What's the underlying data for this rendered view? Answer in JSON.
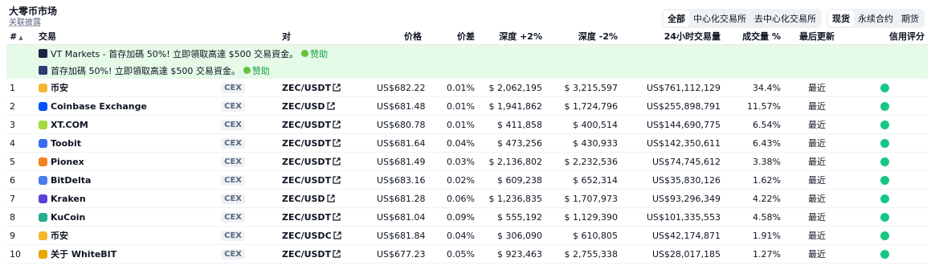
{
  "header": {
    "title": "大零币市场",
    "subtitle": "关联披露"
  },
  "filters": {
    "market_group": [
      {
        "label": "全部",
        "active": true
      },
      {
        "label": "中心化交易所",
        "active": false
      },
      {
        "label": "去中心化交易所",
        "active": false
      }
    ],
    "type_group": [
      {
        "label": "现货",
        "active": true
      },
      {
        "label": "永续合约",
        "active": false
      },
      {
        "label": "期货",
        "active": false
      }
    ]
  },
  "table": {
    "headers": {
      "rank": "#",
      "exchange": "交易",
      "pair": "对",
      "price": "价格",
      "spread": "价差",
      "depth_plus": "深度 +2%",
      "depth_minus": "深度 -2%",
      "volume": "24小时交易量",
      "volume_pct": "成交量 %",
      "updated": "最后更新",
      "trust": "信用评分"
    },
    "ads": [
      {
        "text": "VT Markets - 首存加碼 50%! 立即領取高達 $500 交易資金。",
        "sponsor": "赞助"
      },
      {
        "text": "首存加碼 50%! 立即領取高達 $500 交易資金。",
        "sponsor": "赞助"
      }
    ],
    "rows": [
      {
        "rank": "1",
        "exchange": "币安",
        "logo_color": "#f3ba2f",
        "category": "CEX",
        "pair": "ZEC/USDT",
        "price": "US$682.22",
        "spread": "0.01%",
        "depth_plus": "$ 2,062,195",
        "depth_minus": "$ 3,215,597",
        "volume": "US$761,112,129",
        "volume_pct": "34.4%",
        "updated": "最近",
        "trust_color": "#16c784"
      },
      {
        "rank": "2",
        "exchange": "Coinbase Exchange",
        "logo_color": "#0052ff",
        "category": "CEX",
        "pair": "ZEC/USD",
        "price": "US$681.48",
        "spread": "0.01%",
        "depth_plus": "$ 1,941,862",
        "depth_minus": "$ 1,724,796",
        "volume": "US$255,898,791",
        "volume_pct": "11.57%",
        "updated": "最近",
        "trust_color": "#16c784"
      },
      {
        "rank": "3",
        "exchange": "XT.COM",
        "logo_color": "#a3d93f",
        "category": "CEX",
        "pair": "ZEC/USDT",
        "price": "US$680.78",
        "spread": "0.01%",
        "depth_plus": "$ 411,858",
        "depth_minus": "$ 400,514",
        "volume": "US$144,690,775",
        "volume_pct": "6.54%",
        "updated": "最近",
        "trust_color": "#16c784"
      },
      {
        "rank": "4",
        "exchange": "Toobit",
        "logo_color": "#3d6df2",
        "category": "CEX",
        "pair": "ZEC/USDT",
        "price": "US$681.64",
        "spread": "0.04%",
        "depth_plus": "$ 473,256",
        "depth_minus": "$ 430,933",
        "volume": "US$142,350,611",
        "volume_pct": "6.43%",
        "updated": "最近",
        "trust_color": "#16c784"
      },
      {
        "rank": "5",
        "exchange": "Pionex",
        "logo_color": "#f58220",
        "category": "CEX",
        "pair": "ZEC/USDT",
        "price": "US$681.49",
        "spread": "0.03%",
        "depth_plus": "$ 2,136,802",
        "depth_minus": "$ 2,232,536",
        "volume": "US$74,745,612",
        "volume_pct": "3.38%",
        "updated": "最近",
        "trust_color": "#16c784"
      },
      {
        "rank": "6",
        "exchange": "BitDelta",
        "logo_color": "#4b7bec",
        "category": "CEX",
        "pair": "ZEC/USDT",
        "price": "US$683.16",
        "spread": "0.02%",
        "depth_plus": "$ 609,238",
        "depth_minus": "$ 652,314",
        "volume": "US$35,830,126",
        "volume_pct": "1.62%",
        "updated": "最近",
        "trust_color": "#16c784"
      },
      {
        "rank": "7",
        "exchange": "Kraken",
        "logo_color": "#5741d9",
        "category": "CEX",
        "pair": "ZEC/USD",
        "price": "US$681.28",
        "spread": "0.06%",
        "depth_plus": "$ 1,236,835",
        "depth_minus": "$ 1,707,973",
        "volume": "US$93,296,349",
        "volume_pct": "4.22%",
        "updated": "最近",
        "trust_color": "#16c784"
      },
      {
        "rank": "8",
        "exchange": "KuCoin",
        "logo_color": "#23af91",
        "category": "CEX",
        "pair": "ZEC/USDT",
        "price": "US$681.04",
        "spread": "0.09%",
        "depth_plus": "$ 555,192",
        "depth_minus": "$ 1,129,390",
        "volume": "US$101,335,553",
        "volume_pct": "4.58%",
        "updated": "最近",
        "trust_color": "#16c784"
      },
      {
        "rank": "9",
        "exchange": "币安",
        "logo_color": "#f3ba2f",
        "category": "CEX",
        "pair": "ZEC/USDC",
        "price": "US$681.84",
        "spread": "0.04%",
        "depth_plus": "$ 306,090",
        "depth_minus": "$ 610,805",
        "volume": "US$42,174,871",
        "volume_pct": "1.91%",
        "updated": "最近",
        "trust_color": "#16c784"
      },
      {
        "rank": "10",
        "exchange": "关于 WhiteBIT",
        "logo_color": "#e6a700",
        "category": "CEX",
        "pair": "ZEC/USDT",
        "price": "US$677.23",
        "spread": "0.05%",
        "depth_plus": "$ 923,463",
        "depth_minus": "$ 2,755,338",
        "volume": "US$28,017,185",
        "volume_pct": "1.27%",
        "updated": "最近",
        "trust_color": "#16c784"
      }
    ]
  }
}
